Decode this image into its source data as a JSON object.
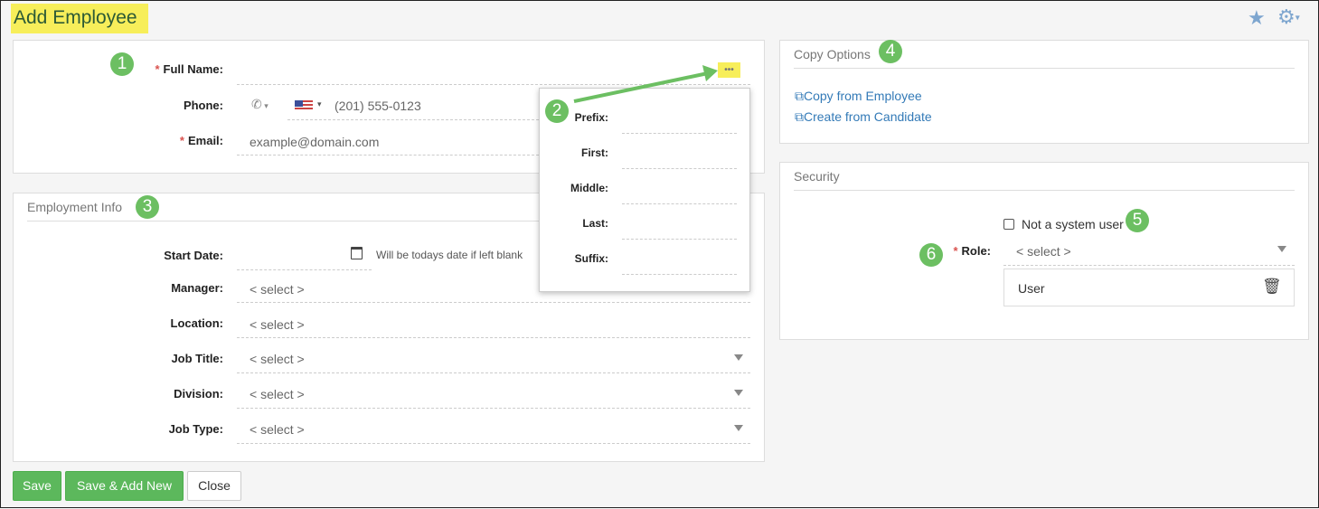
{
  "header": {
    "title": "Add Employee",
    "favorite_icon": "star-icon",
    "settings_icon": "gear-icon"
  },
  "contact": {
    "full_name_label": "Full Name:",
    "phone_label": "Phone:",
    "phone_placeholder": "(201) 555-0123",
    "email_label": "Email:",
    "email_placeholder": "example@domain.com",
    "more_icon": "•••"
  },
  "name_popup": {
    "prefix": "Prefix:",
    "first": "First:",
    "middle": "Middle:",
    "last": "Last:",
    "suffix": "Suffix:"
  },
  "employment": {
    "title": "Employment Info",
    "start_date_label": "Start Date:",
    "start_date_hint": "Will be todays date if left blank",
    "manager_label": "Manager:",
    "manager_value": "< select >",
    "location_label": "Location:",
    "location_value": "< select >",
    "job_title_label": "Job Title:",
    "job_title_value": "< select >",
    "division_label": "Division:",
    "division_value": "< select >",
    "job_type_label": "Job Type:",
    "job_type_value": "< select >"
  },
  "copy_options": {
    "title": "Copy Options",
    "copy_from_employee": "Copy from Employee",
    "create_from_candidate": "Create from Candidate"
  },
  "security": {
    "title": "Security",
    "not_system_user": "Not a system user",
    "not_system_user_checked": false,
    "role_label": "Role:",
    "role_value": "< select >",
    "role_item": "User"
  },
  "buttons": {
    "save": "Save",
    "save_add_new": "Save & Add New",
    "close": "Close"
  },
  "badges": [
    "1",
    "2",
    "3",
    "4",
    "5",
    "6"
  ],
  "colors": {
    "accent_green": "#5cb85c",
    "highlight": "#f7ee5a",
    "link": "#337ab7",
    "required": "#d9534f"
  }
}
